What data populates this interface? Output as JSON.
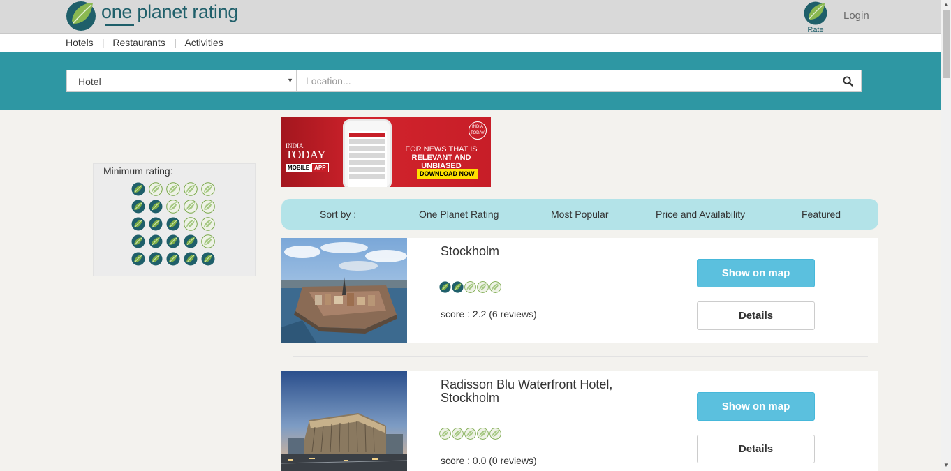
{
  "header": {
    "logo_text": "one planet rating",
    "rate_label": "Rate",
    "login_label": "Login"
  },
  "nav": {
    "items": [
      "Hotels",
      "Restaurants",
      "Activities"
    ],
    "separator": "|"
  },
  "search": {
    "category_value": "Hotel",
    "location_placeholder": "Location...",
    "location_value": ""
  },
  "filter": {
    "title": "Minimum rating:",
    "options": [
      1,
      2,
      3,
      4,
      5
    ]
  },
  "ad": {
    "brand_line1": "INDIA",
    "brand_line2": "TODAY",
    "brand_tag1": "MOBILE",
    "brand_tag2": "APP",
    "copy_line1": "FOR NEWS THAT IS",
    "copy_line2": "RELEVANT AND UNBIASED",
    "cta": "DOWNLOAD NOW",
    "badge": "INDIA TODAY"
  },
  "sort": {
    "label": "Sort by :",
    "options": [
      "One Planet Rating",
      "Most Popular",
      "Price and Availability",
      "Featured"
    ]
  },
  "results": [
    {
      "name": "Stockholm",
      "rating_leaves": 2,
      "score_text": "score : 2.2 (6 reviews)",
      "map_label": "Show on map",
      "details_label": "Details"
    },
    {
      "name": "Radisson Blu Waterfront Hotel, Stockholm",
      "rating_leaves": 0,
      "score_text": "score : 0.0 (0 reviews)",
      "map_label": "Show on map",
      "details_label": "Details"
    }
  ],
  "colors": {
    "brand_teal": "#2e97a3",
    "brand_dark": "#1f5f6a",
    "leaf_filled": "#1f5f6a",
    "leaf_empty": "#7aa84a",
    "sort_bg": "#b3e3e8",
    "map_button": "#5bc0de"
  }
}
